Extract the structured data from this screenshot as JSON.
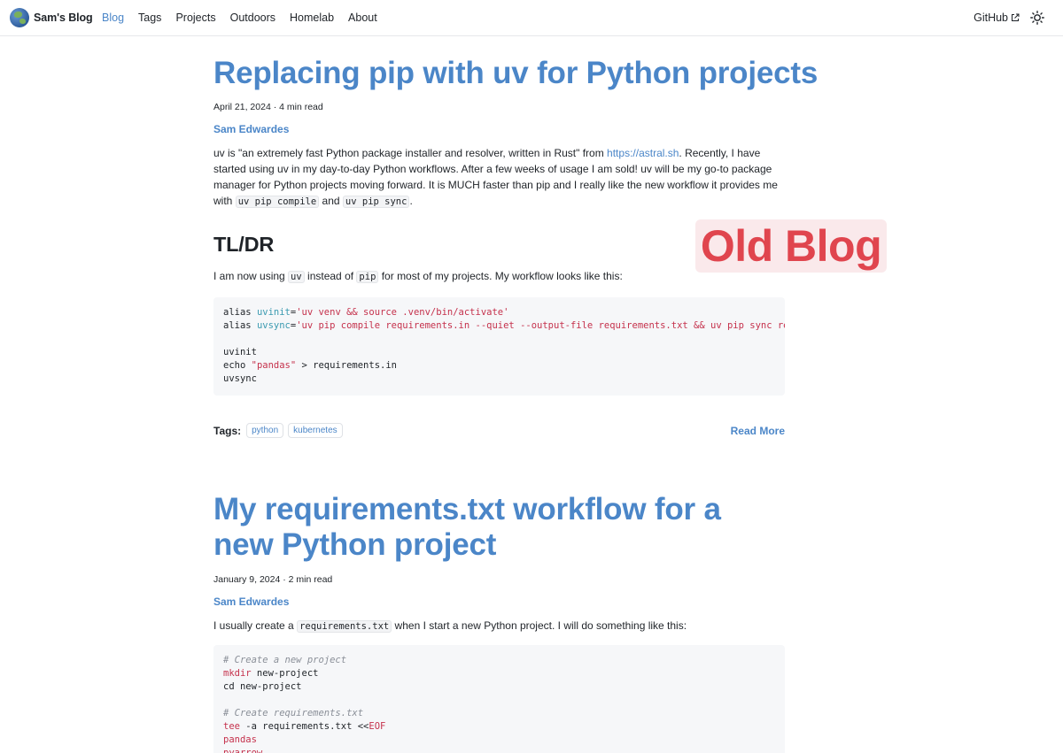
{
  "header": {
    "brand": "Sam's Blog",
    "nav": [
      "Blog",
      "Tags",
      "Projects",
      "Outdoors",
      "Homelab",
      "About"
    ],
    "active_nav": "Blog",
    "github_label": "GitHub"
  },
  "badge": {
    "text": "Old Blog"
  },
  "posts": [
    {
      "title": "Replacing pip with uv for Python projects",
      "meta": "April 21, 2024 · 4 min read",
      "author": "Sam Edwardes",
      "intro": {
        "p1": "uv is \"an extremely fast Python package installer and resolver, written in Rust\" from ",
        "link": "https://astral.sh",
        "p2": ". Recently, I have started using uv in my day-to-day Python workflows. After a few weeks of usage I am sold! uv will be my go-to package manager for Python projects moving forward. It is MUCH faster than pip and I really like the new workflow it provides me with ",
        "code1": "uv pip compile",
        "p3": " and ",
        "code2": "uv pip sync",
        "p4": "."
      },
      "section_heading": "TL/DR",
      "tldr": {
        "p1": "I am now using ",
        "code1": "uv",
        "p2": " instead of ",
        "code2": "pip",
        "p3": " for most of my projects. My workflow looks like this:"
      },
      "code": {
        "alias_kw": "alias",
        "uvinit_name": "uvinit",
        "uvinit_val": "'uv venv && source .venv/bin/activate'",
        "uvsync_name": "uvsync",
        "uvsync_val": "'uv pip compile requirements.in --quiet --output-file requirements.txt && uv pip sync requirements.txt'",
        "line4": "uvinit",
        "echo_kw": "echo",
        "echo_str": "\"pandas\"",
        "echo_rest": " > requirements.in",
        "line6": "uvsync"
      },
      "tags_label": "Tags:",
      "tags": [
        "python",
        "kubernetes"
      ],
      "read_more": "Read More"
    },
    {
      "title": "My requirements.txt workflow for a new Python project",
      "meta": "January 9, 2024 · 2 min read",
      "author": "Sam Edwardes",
      "intro": {
        "p1": "I usually create a ",
        "code1": "requirements.txt",
        "p2": " when I start a new Python project. I will do something like this:"
      },
      "code": {
        "c1": "# Create a new project",
        "mkdir_kw": "mkdir",
        "mkdir_rest": " new-project",
        "cd_line": "cd new-project",
        "c2": "# Create requirements.txt",
        "tee_kw": "tee",
        "tee_rest": " -a requirements.txt <<",
        "eof": "EOF",
        "pkg1": "pandas",
        "pkg2": "pyarrow"
      }
    }
  ]
}
